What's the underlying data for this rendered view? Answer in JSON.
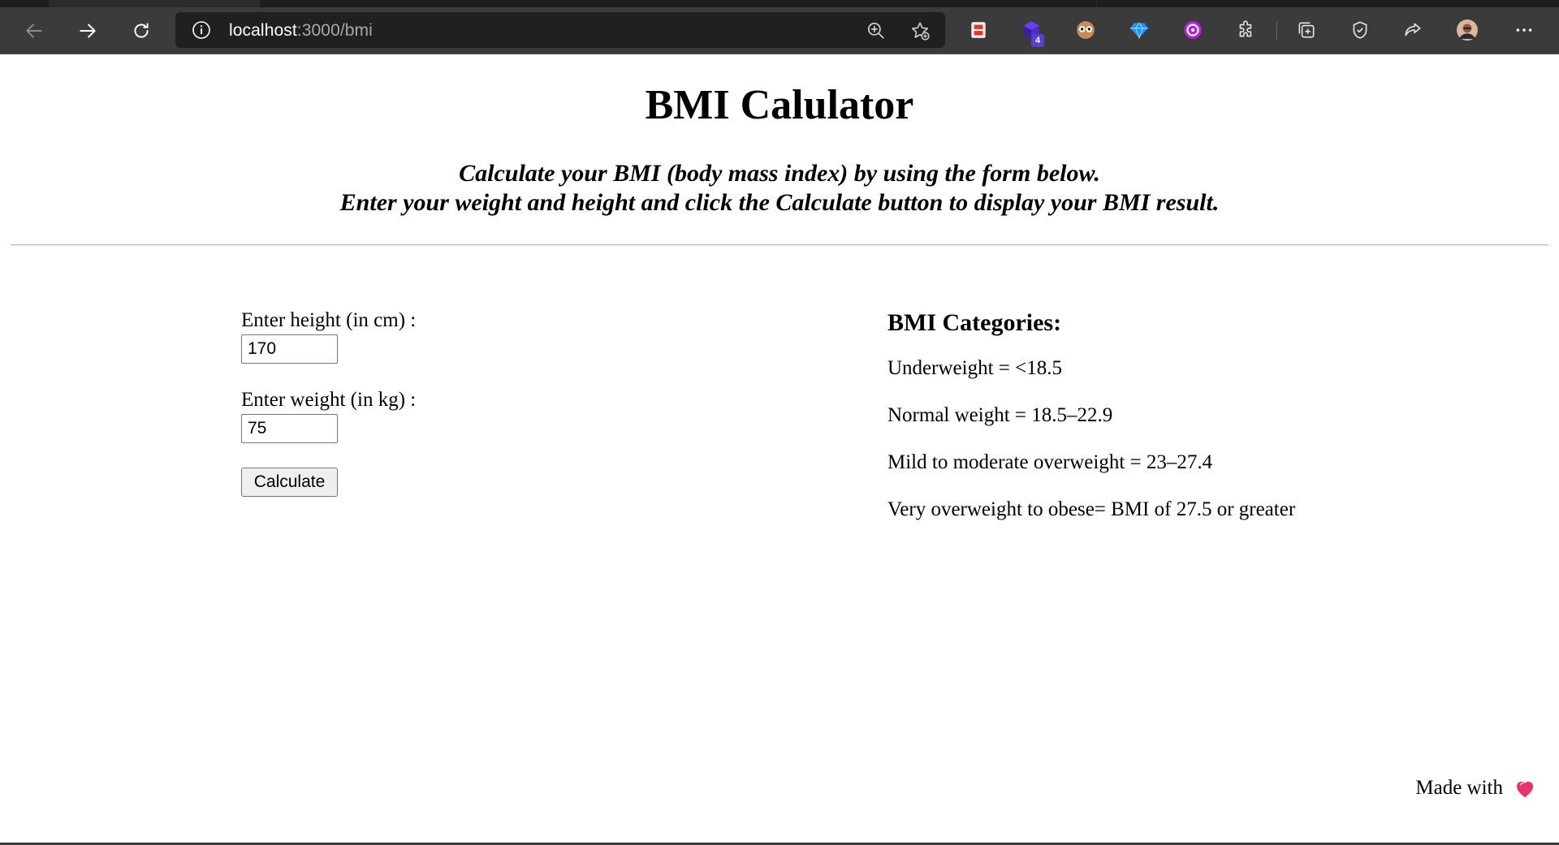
{
  "browser": {
    "url_host": "localhost",
    "url_path": ":3000/bmi",
    "extension_badge": "4"
  },
  "page": {
    "title": "BMI Calulator",
    "subtitle_line1": "Calculate your BMI (body mass index) by using the form below.",
    "subtitle_line2": "Enter your weight and height and click the Calculate button to display your BMI result."
  },
  "form": {
    "height_label": "Enter height (in cm) :",
    "height_value": "170",
    "weight_label": "Enter weight (in kg) :",
    "weight_value": "75",
    "calculate_label": "Calculate"
  },
  "categories": {
    "heading": "BMI Categories:",
    "items": [
      "Underweight = <18.5",
      "Normal weight = 18.5–22.9",
      "Mild to moderate overweight = 23–27.4",
      "Very overweight to obese= BMI of 27.5 or greater"
    ]
  },
  "footer": {
    "text": "Made with"
  },
  "colors": {
    "chrome_bg": "#3b3b3b",
    "address_bar_bg": "#202020",
    "heart": "#e8336d"
  }
}
